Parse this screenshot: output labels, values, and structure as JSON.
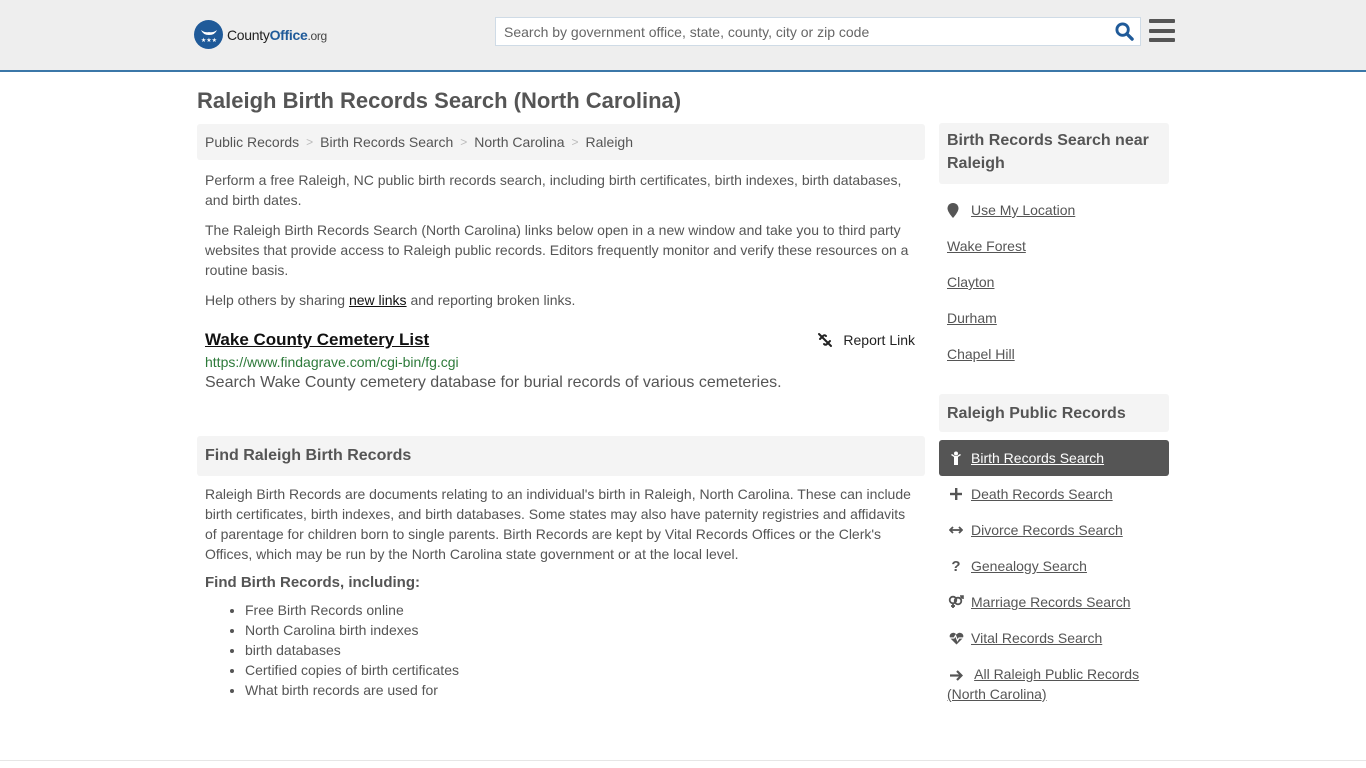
{
  "header": {
    "logo": {
      "county": "County",
      "office": "Office",
      "org": ".org",
      "badge_icon": "eagle-stars-icon"
    },
    "search": {
      "placeholder": "Search by government office, state, county, city or zip code",
      "value": ""
    },
    "menu_icon": "hamburger-menu-icon"
  },
  "page": {
    "title": "Raleigh Birth Records Search (North Carolina)"
  },
  "breadcrumb": [
    {
      "label": "Public Records"
    },
    {
      "label": "Birth Records Search"
    },
    {
      "label": "North Carolina"
    },
    {
      "label": "Raleigh"
    }
  ],
  "intro": {
    "p1": "Perform a free Raleigh, NC public birth records search, including birth certificates, birth indexes, birth databases, and birth dates.",
    "p2": "The Raleigh Birth Records Search (North Carolina) links below open in a new window and take you to third party websites that provide access to Raleigh public records. Editors frequently monitor and verify these resources on a routine basis.",
    "p3_before": "Help others by sharing ",
    "p3_link": "new links",
    "p3_after": " and reporting broken links."
  },
  "results": [
    {
      "title": "Wake County Cemetery List",
      "url": "https://www.findagrave.com/cgi-bin/fg.cgi",
      "description": "Search Wake County cemetery database for burial records of various cemeteries.",
      "report_label": "Report Link"
    }
  ],
  "find_section": {
    "heading": "Find Raleigh Birth Records",
    "body": "Raleigh Birth Records are documents relating to an individual's birth in Raleigh, North Carolina. These can include birth certificates, birth indexes, and birth databases. Some states may also have paternity registries and affidavits of parentage for children born to single parents. Birth Records are kept by Vital Records Offices or the Clerk's Offices, which may be run by the North Carolina state government or at the local level.",
    "sub_heading": "Find Birth Records, including:",
    "bullets": [
      "Free Birth Records online",
      "North Carolina birth indexes",
      "birth databases",
      "Certified copies of birth certificates",
      "What birth records are used for"
    ]
  },
  "sidebar": {
    "near_heading": "Birth Records Search near Raleigh",
    "use_location": "Use My Location",
    "nearby": [
      "Wake Forest",
      "Clayton",
      "Durham",
      "Chapel Hill"
    ],
    "records_heading": "Raleigh Public Records",
    "records": [
      {
        "label": "Birth Records Search",
        "icon": "child-icon",
        "active": true
      },
      {
        "label": "Death Records Search",
        "icon": "cross-icon",
        "active": false
      },
      {
        "label": "Divorce Records Search",
        "icon": "arrows-horizontal-icon",
        "active": false
      },
      {
        "label": "Genealogy Search",
        "icon": "question-icon",
        "active": false
      },
      {
        "label": "Marriage Records Search",
        "icon": "venus-mars-icon",
        "active": false
      },
      {
        "label": "Vital Records Search",
        "icon": "heartbeat-icon",
        "active": false
      },
      {
        "label": "All Raleigh Public Records (North Carolina)",
        "icon": "arrow-right-icon",
        "active": false
      }
    ]
  },
  "colors": {
    "brand_blue": "#1f5a99",
    "header_border": "#3b77a8",
    "url_green": "#2d7a3a",
    "active_bg": "#555555"
  }
}
